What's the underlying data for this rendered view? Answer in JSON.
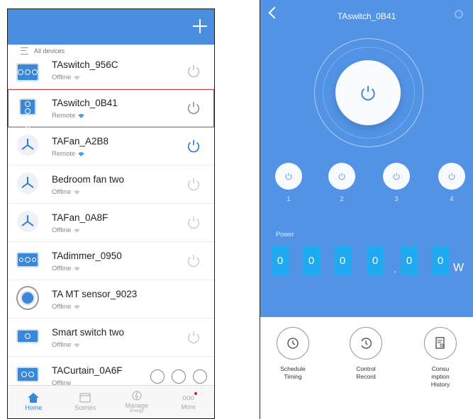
{
  "left": {
    "header": {
      "filter_label": "All devices"
    },
    "devices": [
      {
        "name": "TAswitch_956C",
        "status": "Offline",
        "icon": "switch-3gang",
        "power": "off"
      },
      {
        "name": "TAswitch_0B41",
        "status": "Remote",
        "icon": "switch-4gang",
        "power": "off",
        "selected": true
      },
      {
        "name": "TAFan_A2B8",
        "status": "Remote",
        "icon": "fan",
        "power": "on"
      },
      {
        "name": "Bedroom fan two",
        "status": "Offline",
        "icon": "fan",
        "power": "off"
      },
      {
        "name": "TAFan_0A8F",
        "status": "Offline",
        "icon": "fan",
        "power": "off"
      },
      {
        "name": "TAdimmer_0950",
        "status": "Offline",
        "icon": "dimmer",
        "power": "off"
      },
      {
        "name": "TA MT sensor_9023",
        "status": "Offline",
        "icon": "sensor",
        "power": "none"
      },
      {
        "name": "Smart switch two",
        "status": "Offline",
        "icon": "switch-1gang",
        "power": "off"
      },
      {
        "name": "TACurtain_0A6F",
        "status": "Offline",
        "icon": "curtain",
        "power": "curtain-controls"
      }
    ],
    "tabs": [
      {
        "label": "Home",
        "sub": ""
      },
      {
        "label": "Scenes",
        "sub": ""
      },
      {
        "label": "Manage",
        "sub": "Energy"
      },
      {
        "label": "More",
        "sub": ""
      }
    ]
  },
  "right": {
    "title": "TAswitch_0B41",
    "channels": [
      "1",
      "2",
      "3",
      "4"
    ],
    "power_label": "Power",
    "power_digits": [
      "0",
      "0",
      "0",
      "0",
      "0",
      "0"
    ],
    "power_separator": ".",
    "power_unit": "W",
    "features": [
      {
        "label": "Schedule\nTiming",
        "icon": "clock-icon"
      },
      {
        "label": "Control\nRecord",
        "icon": "history-icon"
      },
      {
        "label": "Consu\nmption\nHistory",
        "icon": "report-icon"
      }
    ]
  },
  "colors": {
    "accent": "#4a8ee0",
    "panel": "#5293e6",
    "digit": "#1fa9f0",
    "highlight": "#d9363e"
  }
}
